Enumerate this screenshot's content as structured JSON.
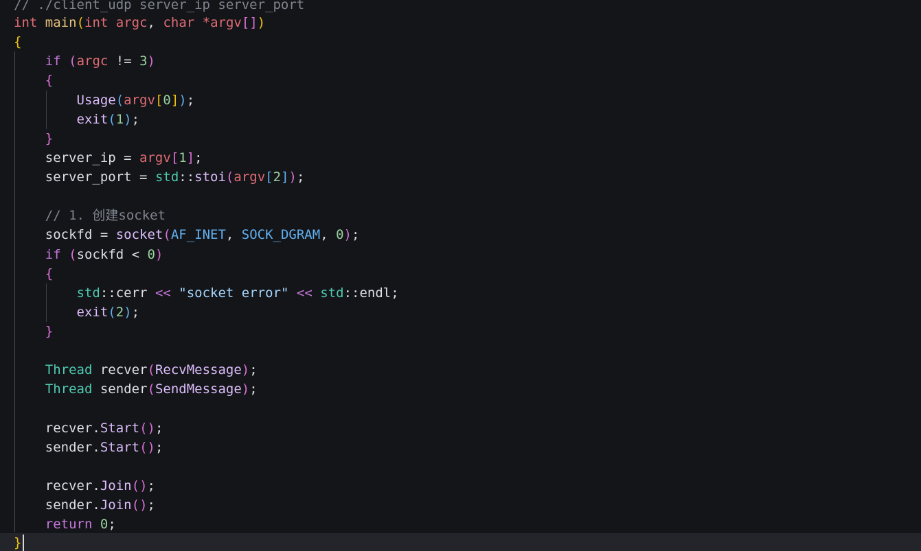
{
  "editor": {
    "theme_colors": {
      "background": "#141519",
      "current_line": "#23252b",
      "keyword": "#e06c75",
      "control": "#c678dd",
      "function": "#dcbdfb",
      "type": "#4ec9b0",
      "macro": "#61afef",
      "comment": "#7f848e",
      "string": "#a5d6ff",
      "number": "#9ad0a0"
    },
    "cursor_line": 28,
    "lines": [
      "// ./client_udp server_ip server_port",
      "int main(int argc, char *argv[])",
      "{",
      "    if (argc != 3)",
      "    {",
      "        Usage(argv[0]);",
      "        exit(1);",
      "    }",
      "    server_ip = argv[1];",
      "    server_port = std::stoi(argv[2]);",
      "",
      "    // 1. 创建socket",
      "    sockfd = socket(AF_INET, SOCK_DGRAM, 0);",
      "    if (sockfd < 0)",
      "    {",
      "        std::cerr << \"socket error\" << std::endl;",
      "        exit(2);",
      "    }",
      "",
      "    Thread recver(RecvMessage);",
      "    Thread sender(SendMessage);",
      "",
      "    recver.Start();",
      "    sender.Start();",
      "",
      "    recver.Join();",
      "    sender.Join();",
      "    return 0;",
      "}"
    ]
  }
}
